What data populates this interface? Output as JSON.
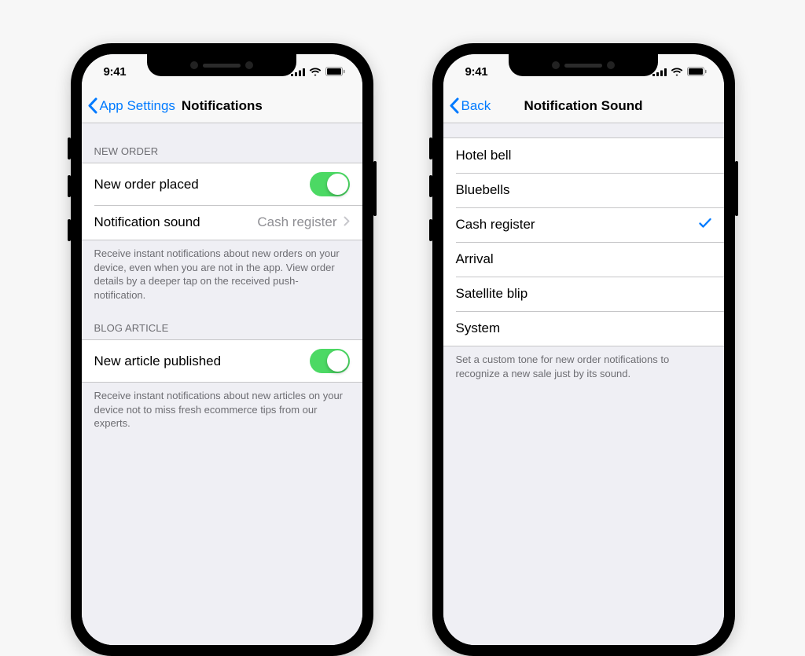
{
  "status": {
    "time": "9:41"
  },
  "left": {
    "back_label": "App Settings",
    "title": "Notifications",
    "section1": {
      "header": "NEW ORDER",
      "row_toggle": {
        "label": "New order placed",
        "on": true
      },
      "row_detail": {
        "label": "Notification sound",
        "value": "Cash register"
      },
      "footer": "Receive instant notifications about new orders on your device, even when you are not in the app. View order details by a deeper tap on the received push-notification."
    },
    "section2": {
      "header": "BLOG ARTICLE",
      "row_toggle": {
        "label": "New article published",
        "on": true
      },
      "footer": "Receive instant notifications about new articles on your device not to miss fresh ecommerce tips from our experts."
    }
  },
  "right": {
    "back_label": "Back",
    "title": "Notification Sound",
    "options": [
      {
        "label": "Hotel bell",
        "selected": false
      },
      {
        "label": "Bluebells",
        "selected": false
      },
      {
        "label": "Cash register",
        "selected": true
      },
      {
        "label": "Arrival",
        "selected": false
      },
      {
        "label": "Satellite blip",
        "selected": false
      },
      {
        "label": "System",
        "selected": false
      }
    ],
    "footer": "Set a custom tone for new order notifications to recognize a new sale just by its sound."
  }
}
